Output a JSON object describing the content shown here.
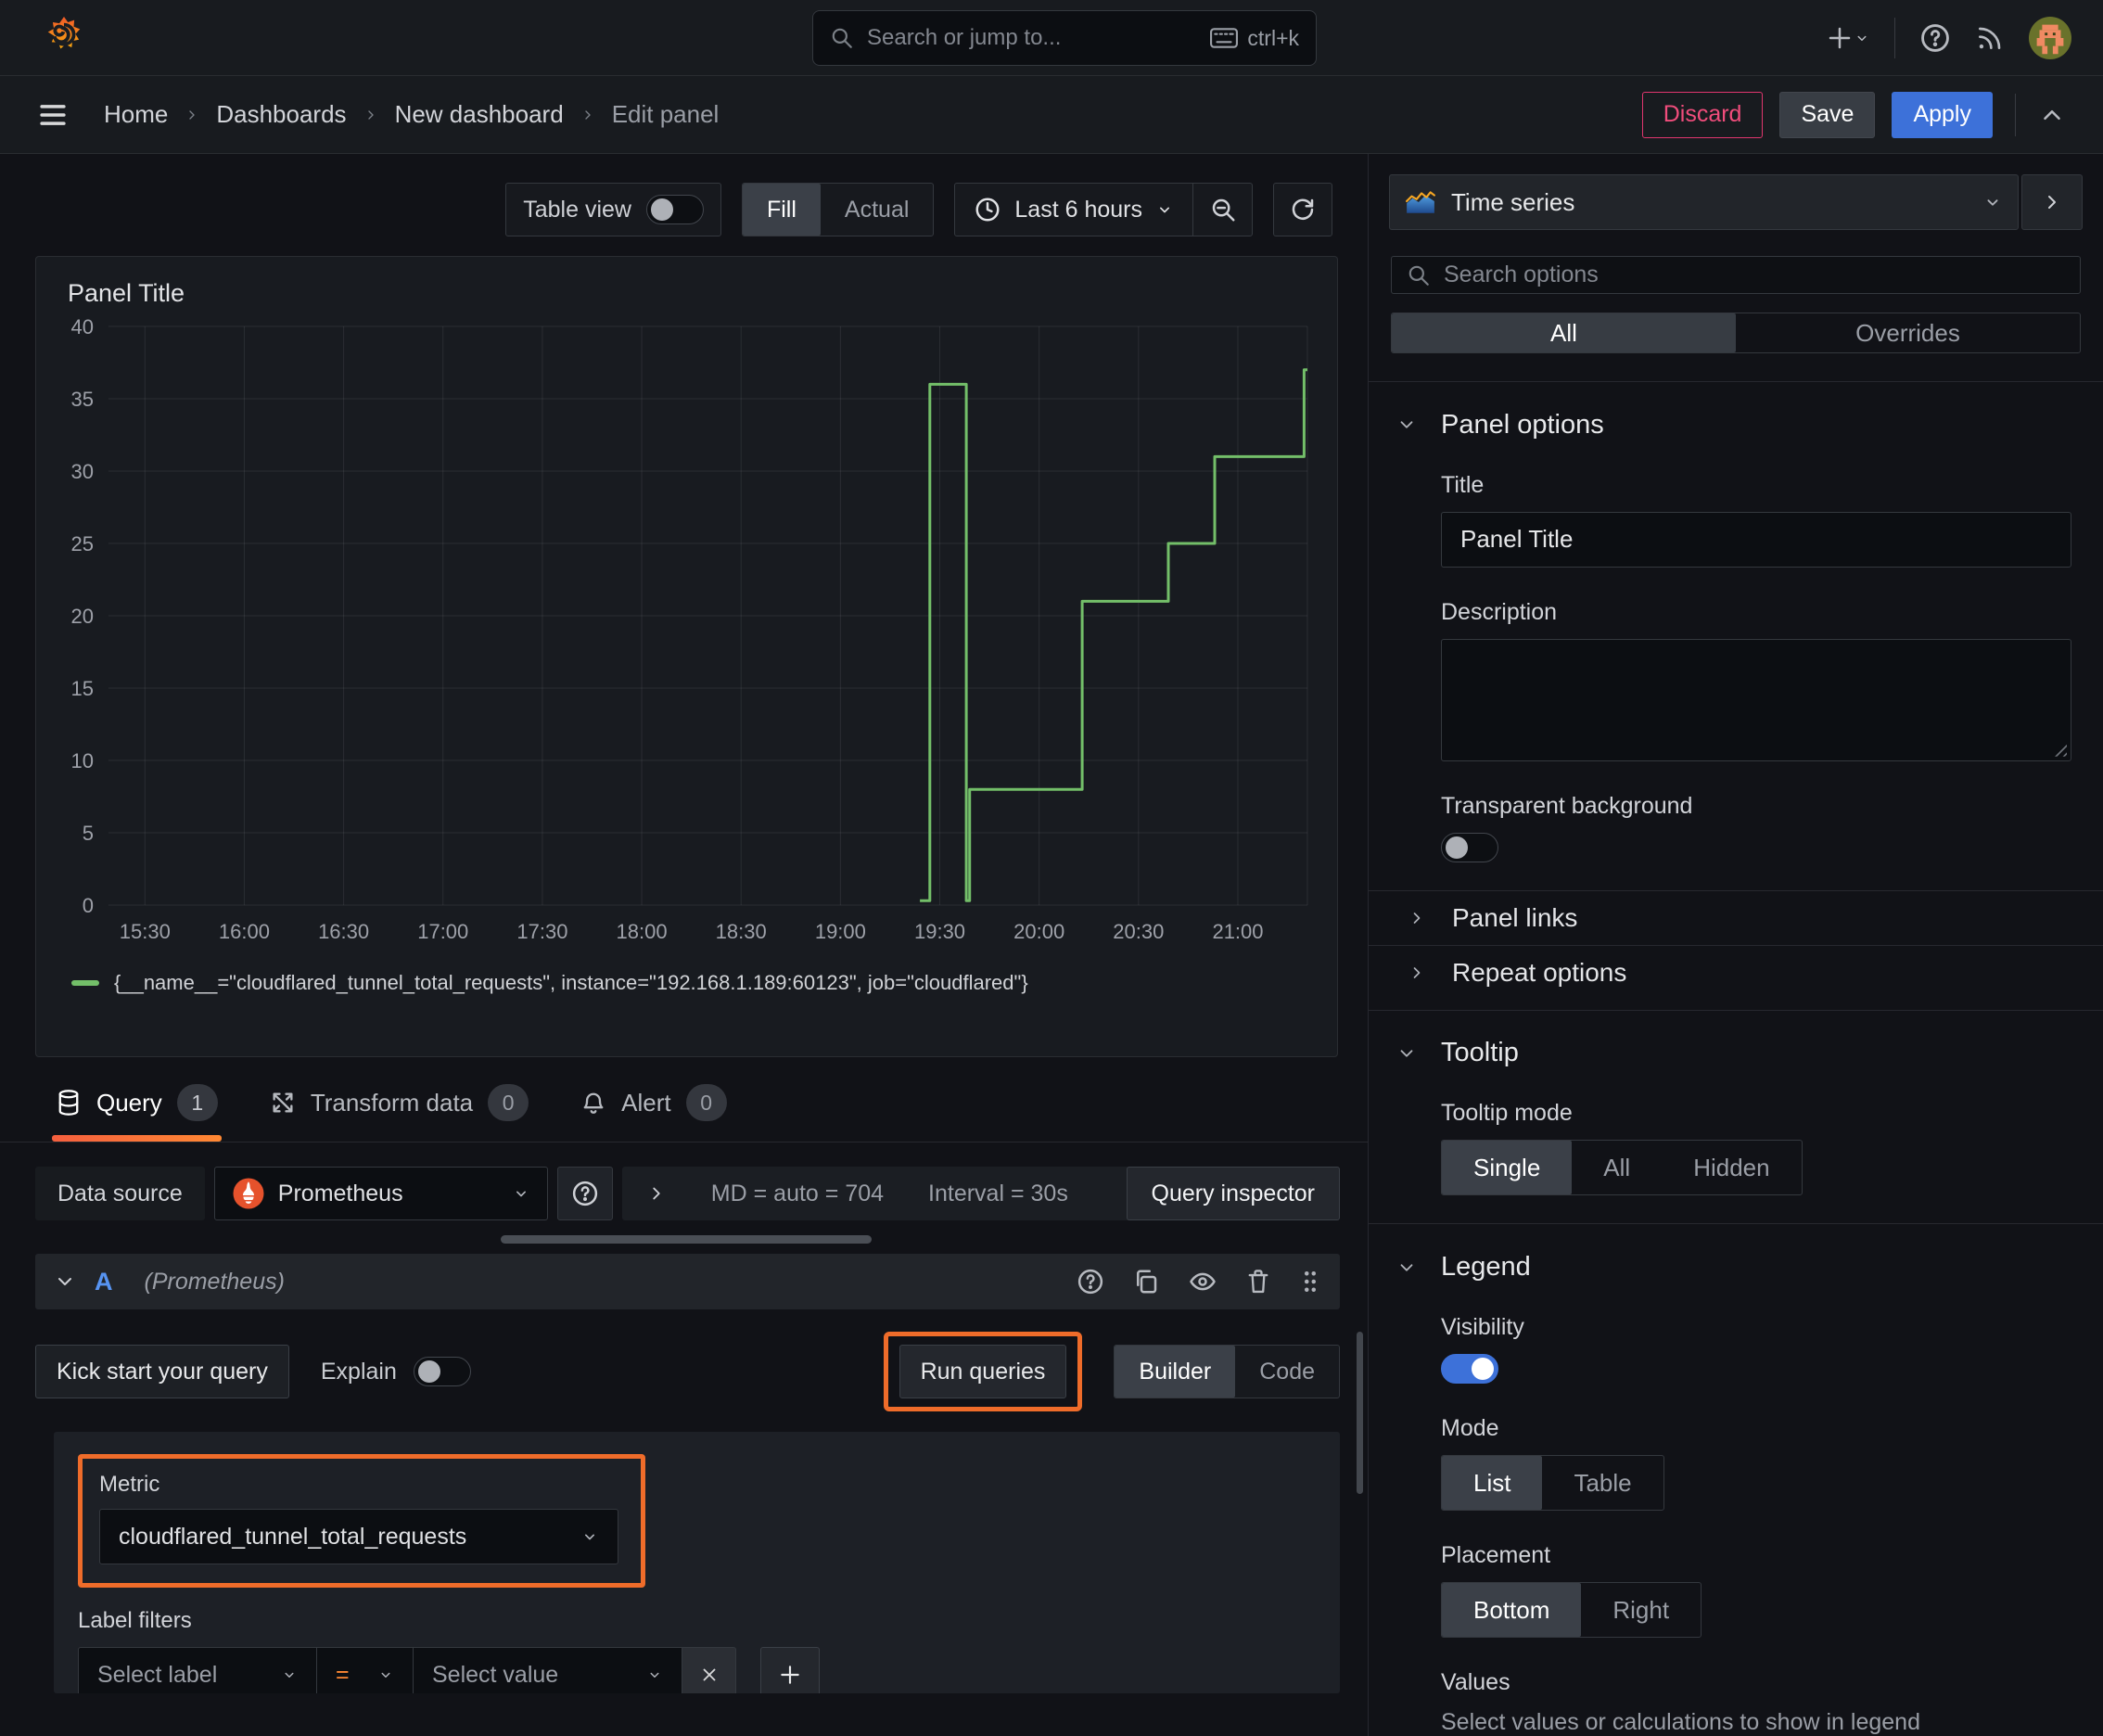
{
  "topnav": {
    "search_placeholder": "Search or jump to...",
    "search_shortcut": "ctrl+k"
  },
  "breadcrumb": {
    "items": [
      "Home",
      "Dashboards",
      "New dashboard",
      "Edit panel"
    ],
    "discard_label": "Discard",
    "save_label": "Save",
    "apply_label": "Apply"
  },
  "toolbar": {
    "table_view_label": "Table view",
    "fill_label": "Fill",
    "actual_label": "Actual",
    "time_range_label": "Last 6 hours"
  },
  "panel": {
    "title": "Panel Title"
  },
  "chart_data": {
    "type": "line",
    "line_style": "step-after",
    "title": "Panel Title",
    "xlabel": "",
    "ylabel": "",
    "ylim": [
      0,
      40
    ],
    "y_tick_step": 5,
    "grid": true,
    "legend_position": "bottom",
    "x_domain": [
      "15:19",
      "21:21"
    ],
    "x_ticks": [
      "15:30",
      "16:00",
      "16:30",
      "17:00",
      "17:30",
      "18:00",
      "18:30",
      "19:00",
      "19:30",
      "20:00",
      "20:30",
      "21:00"
    ],
    "series": [
      {
        "name": "{__name__=\"cloudflared_tunnel_total_requests\", instance=\"192.168.1.189:60123\", job=\"cloudflared\"}",
        "color": "#73bf69",
        "steps": [
          [
            "19:24",
            0.3
          ],
          [
            "19:27",
            36
          ],
          [
            "19:38",
            0.3
          ],
          [
            "19:39",
            8
          ],
          [
            "20:13",
            21
          ],
          [
            "20:39",
            25
          ],
          [
            "20:53",
            31
          ],
          [
            "21:20",
            37
          ]
        ],
        "end_time": "21:21"
      }
    ]
  },
  "tabs": {
    "query_label": "Query",
    "query_count": "1",
    "transform_label": "Transform data",
    "transform_count": "0",
    "alert_label": "Alert",
    "alert_count": "0"
  },
  "datasource": {
    "label": "Data source",
    "name": "Prometheus",
    "stat_md": "MD = auto = 704",
    "stat_interval": "Interval = 30s",
    "inspector_label": "Query inspector"
  },
  "query": {
    "ref_id": "A",
    "ds_hint": "(Prometheus)",
    "kick_start_label": "Kick start your query",
    "explain_label": "Explain",
    "run_queries_label": "Run queries",
    "builder_label": "Builder",
    "code_label": "Code",
    "metric_label": "Metric",
    "metric_value": "cloudflared_tunnel_total_requests",
    "label_filters_label": "Label filters",
    "select_label_placeholder": "Select label",
    "operator": "=",
    "select_value_placeholder": "Select value",
    "remove_filter": "x"
  },
  "sidebar": {
    "visualization": "Time series",
    "search_placeholder": "Search options",
    "tab_all": "All",
    "tab_overrides": "Overrides",
    "panel_options": {
      "title": "Panel options",
      "title_label": "Title",
      "title_value": "Panel Title",
      "description_label": "Description",
      "transparent_label": "Transparent background"
    },
    "panel_links_label": "Panel links",
    "repeat_options_label": "Repeat options",
    "tooltip": {
      "title": "Tooltip",
      "mode_label": "Tooltip mode",
      "options": [
        "Single",
        "All",
        "Hidden"
      ]
    },
    "legend": {
      "title": "Legend",
      "visibility_label": "Visibility",
      "mode_label": "Mode",
      "mode_options": [
        "List",
        "Table"
      ],
      "placement_label": "Placement",
      "placement_options": [
        "Bottom",
        "Right"
      ],
      "values_label": "Values",
      "values_hint": "Select values or calculations to show in legend"
    }
  },
  "colors": {
    "series_green": "#73bf69",
    "accent_blue": "#3d71d9",
    "annotation_orange": "#ef6c2a",
    "discard_pink": "#f14d7c"
  }
}
